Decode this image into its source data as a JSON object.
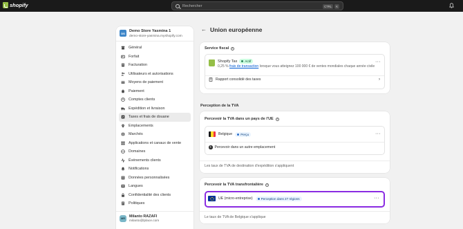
{
  "topbar": {
    "brand": "shopify",
    "search_placeholder": "Rechercher",
    "shortcut_ctrl": "CTRL",
    "shortcut_k": "K"
  },
  "sidebar": {
    "store_initials": "DS",
    "store_name": "Demo Store Yasmina 1",
    "store_domain": "demo-store-yasmina.myshopify.com",
    "items": [
      {
        "label": "Général",
        "icon": "store-icon"
      },
      {
        "label": "Forfait",
        "icon": "plan-icon"
      },
      {
        "label": "Facturation",
        "icon": "billing-icon"
      },
      {
        "label": "Utilisateurs et autorisations",
        "icon": "users-icon"
      },
      {
        "label": "Moyens de paiement",
        "icon": "payment-icon"
      },
      {
        "label": "Paiement",
        "icon": "checkout-icon"
      },
      {
        "label": "Comptes clients",
        "icon": "customer-accounts-icon"
      },
      {
        "label": "Expédition et livraison",
        "icon": "shipping-icon"
      },
      {
        "label": "Taxes et frais de douane",
        "icon": "taxes-icon"
      },
      {
        "label": "Emplacements",
        "icon": "location-icon"
      },
      {
        "label": "Marchés",
        "icon": "markets-icon"
      },
      {
        "label": "Applications et canaux de vente",
        "icon": "apps-icon"
      },
      {
        "label": "Domaines",
        "icon": "domains-icon"
      },
      {
        "label": "Événements clients",
        "icon": "events-icon"
      },
      {
        "label": "Notifications",
        "icon": "notifications-icon"
      },
      {
        "label": "Données personnalisées",
        "icon": "custom-data-icon"
      },
      {
        "label": "Langues",
        "icon": "languages-icon"
      },
      {
        "label": "Confidentialité des clients",
        "icon": "privacy-icon"
      },
      {
        "label": "Politiques",
        "icon": "policies-icon"
      }
    ],
    "active_item": "Taxes et frais de douane",
    "user_initials": "MR",
    "user_name": "Milanto RAZAFI",
    "user_email": "milanto@lplace.com"
  },
  "main": {
    "back_label": "←",
    "title": "Union européenne",
    "fiscal": {
      "title": "Service fiscal",
      "app_name": "Shopify Tax",
      "status": "Actif",
      "desc_prefix": "0,25 % ",
      "desc_link": "frais de transaction",
      "desc_suffix": " lorsque vous atteignez 100 000 € de ventes mondiales chaque année civile",
      "report_label": "Rapport consolidé des taxes"
    },
    "perception_header": "Perception de la TVA",
    "eu_card": {
      "title": "Percevoir la TVA dans un pays de l'UE",
      "country": "Belgique",
      "country_status": "Perçu",
      "add_location": "Percevoir dans un autre emplacement",
      "footer": "Les taux de TVA de destination d'expédition s'appliquent"
    },
    "cross_card": {
      "title": "Percevoir la TVA transfrontalière",
      "region": "UE (micro-entreprise)",
      "region_badge": "Perception dans 27 régions",
      "footer": "Le taux de TVA de Belgique s'applique"
    }
  }
}
